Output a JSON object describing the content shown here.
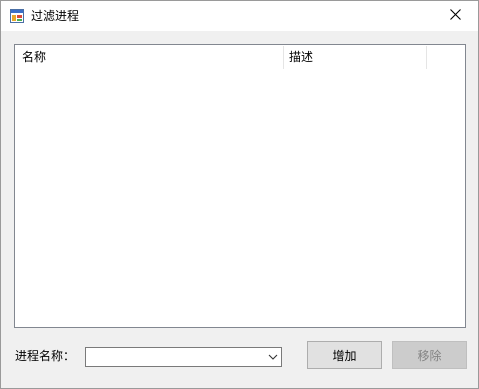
{
  "window": {
    "title": "过滤进程",
    "icon": "app-window-icon",
    "close_icon": "close-icon"
  },
  "list": {
    "columns": [
      "名称",
      "描述"
    ],
    "rows": []
  },
  "form": {
    "process_name_label": "进程名称：",
    "process_name_value": "",
    "add_label": "增加",
    "remove_label": "移除"
  },
  "colors": {
    "titlebar_bg": "#ffffff",
    "window_bg": "#f0f0f0",
    "button_bg": "#e1e1e1",
    "disabled_text": "#838383"
  }
}
